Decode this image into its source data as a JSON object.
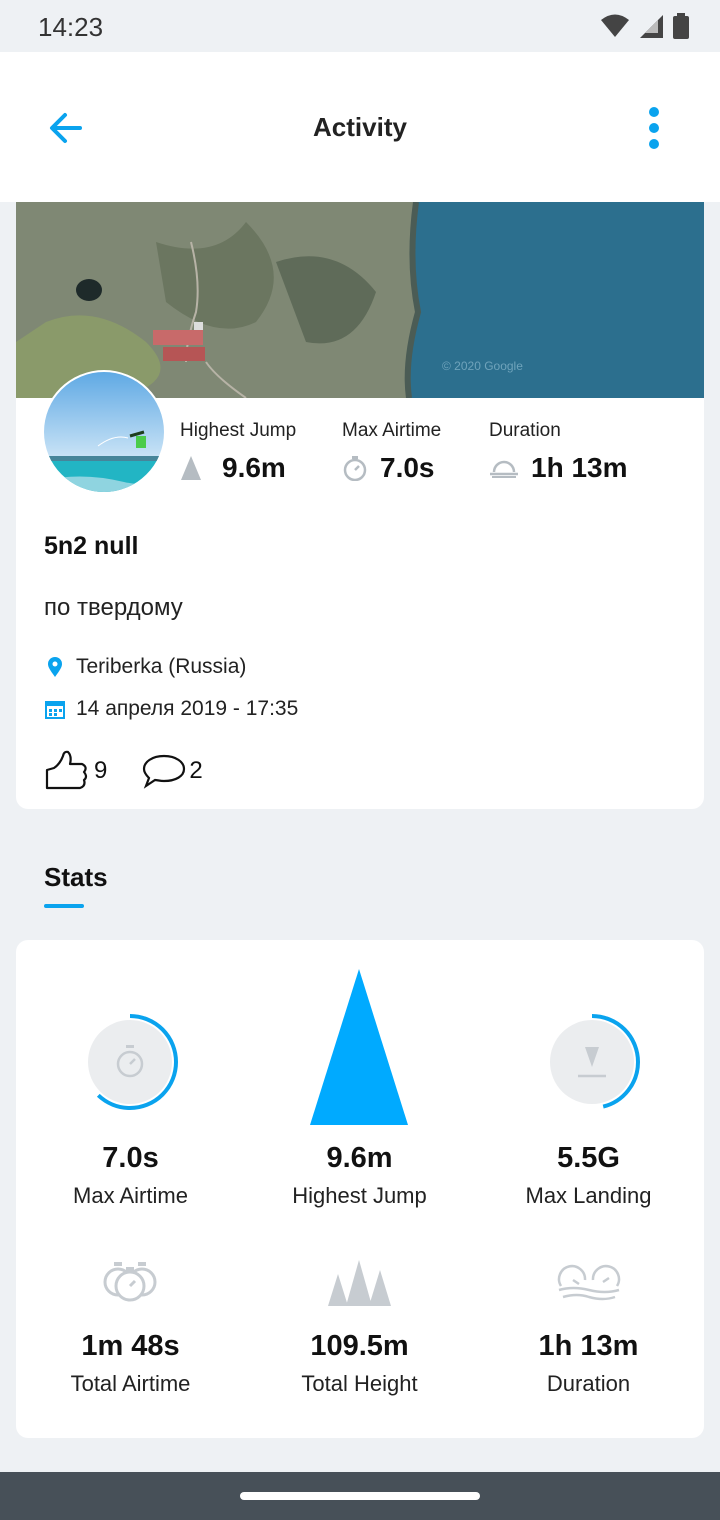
{
  "status_bar": {
    "time": "14:23"
  },
  "app_bar": {
    "title": "Activity"
  },
  "activity": {
    "map_watermark": "© 2020 Google",
    "metrics": [
      {
        "label": "Highest Jump",
        "value": "9.6m",
        "icon": "mountain-icon"
      },
      {
        "label": "Max Airtime",
        "value": "7.0s",
        "icon": "stopwatch-icon"
      },
      {
        "label": "Duration",
        "value": "1h 13m",
        "icon": "clock-icon"
      }
    ],
    "title": "5n2 null",
    "description": "по твердому",
    "location": "Teriberka (Russia)",
    "date": "14 апреля 2019 - 17:35",
    "likes": "9",
    "comments": "2"
  },
  "stats_tab": {
    "label": "Stats"
  },
  "stats": {
    "items": [
      {
        "value": "7.0s",
        "label": "Max Airtime",
        "icon": "stopwatch-icon",
        "progress": 0.62
      },
      {
        "value": "9.6m",
        "label": "Highest Jump",
        "icon": "height-triangle-icon"
      },
      {
        "value": "5.5G",
        "label": "Max Landing",
        "icon": "landing-icon",
        "progress": 0.46
      },
      {
        "value": "1m 48s",
        "label": "Total Airtime",
        "icon": "double-stopwatch-icon"
      },
      {
        "value": "109.5m",
        "label": "Total Height",
        "icon": "triple-mountain-icon"
      },
      {
        "value": "1h 13m",
        "label": "Duration",
        "icon": "session-clock-icon"
      }
    ]
  },
  "colors": {
    "accent": "#0aa3ee",
    "bright_blue": "#00aaff",
    "grey_icon": "#c7ccd1"
  }
}
